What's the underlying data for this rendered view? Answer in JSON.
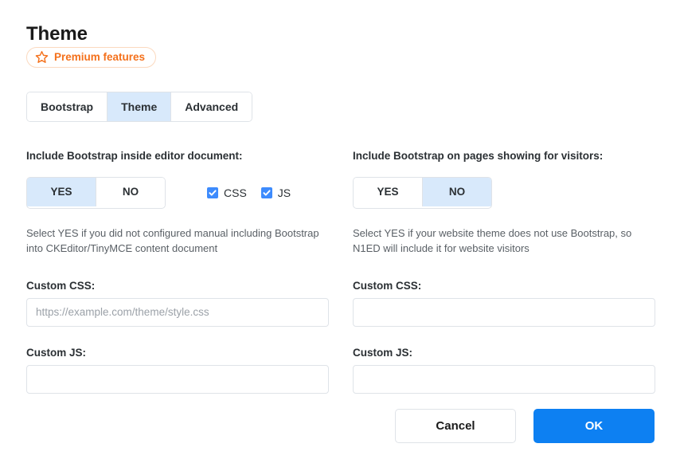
{
  "header": {
    "title": "Theme",
    "premium_badge": {
      "label": "Premium features",
      "icon": "star-outline-icon",
      "color": "#f4701b",
      "border_color": "#fbd9bf"
    }
  },
  "tabs": [
    {
      "label": "Bootstrap",
      "active": false
    },
    {
      "label": "Theme",
      "active": true
    },
    {
      "label": "Advanced",
      "active": false
    }
  ],
  "colors": {
    "accent_blue": "#0d80f2",
    "active_tab_bg": "#d8e9fb",
    "checkbox_blue": "#3d8bfd",
    "premium_orange": "#f4701b",
    "border_gray": "#dfe3e8"
  },
  "left_column": {
    "section_label": "Include Bootstrap inside editor document:",
    "toggle": {
      "yes_label": "YES",
      "no_label": "NO",
      "selected": "YES"
    },
    "checkboxes": [
      {
        "label": "CSS",
        "checked": true
      },
      {
        "label": "JS",
        "checked": true
      }
    ],
    "help_text": "Select YES if you did not configured manual including Bootstrap into CKEditor/TinyMCE content document",
    "custom_css": {
      "label": "Custom CSS:",
      "value": "",
      "placeholder": "https://example.com/theme/style.css"
    },
    "custom_js": {
      "label": "Custom JS:",
      "value": "",
      "placeholder": ""
    }
  },
  "right_column": {
    "section_label": "Include Bootstrap on pages showing for visitors:",
    "toggle": {
      "yes_label": "YES",
      "no_label": "NO",
      "selected": "NO"
    },
    "help_text": "Select YES if your website theme does not use Bootstrap, so N1ED will include it for website visitors",
    "custom_css": {
      "label": "Custom CSS:",
      "value": "",
      "placeholder": ""
    },
    "custom_js": {
      "label": "Custom JS:",
      "value": "",
      "placeholder": ""
    }
  },
  "footer": {
    "cancel_label": "Cancel",
    "ok_label": "OK"
  }
}
